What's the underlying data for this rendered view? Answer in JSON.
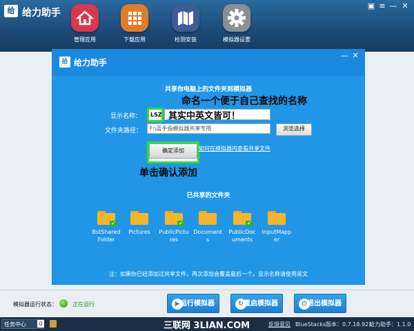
{
  "app": {
    "logo_text": "给",
    "title": "给力助手"
  },
  "nav": [
    {
      "label": "管理应用",
      "icon": "home-icon",
      "color": "#d8374e"
    },
    {
      "label": "下载应用",
      "icon": "grid-icon",
      "color": "#e07b2a"
    },
    {
      "label": "检测安装",
      "icon": "map-icon",
      "color": "#3d5c9a"
    },
    {
      "label": "模拟器设置",
      "icon": "gear-icon",
      "color": "#8a8f96"
    }
  ],
  "window_controls": {
    "skin": "▣",
    "menu": "≡",
    "minimize": "—",
    "close": "✕"
  },
  "dialog": {
    "logo_text": "给",
    "title": "给力助手",
    "minimize": "—",
    "close": "✕",
    "share_heading": "共享你电脑上的文件夹到模拟器",
    "annotation_name": "命名一个便于自己查找的名称",
    "display_name_label": "显示名称：",
    "display_name_value": "LSZ",
    "annotation_lang": "其实中英文皆可！",
    "folder_path_label": "文件夹路径：",
    "folder_path_value": "F:\\蓝手指模拟器共享专用",
    "browse_button": "浏览选择",
    "confirm_button": "确定添加",
    "view_link": "如何在模拟器内查看共享文件",
    "annotation_click": "单击确认添加",
    "shared_heading": "已共享的文件夹",
    "folders": [
      {
        "name": "BstSharedFolder"
      },
      {
        "name": "Pictures"
      },
      {
        "name": "PublicPictures"
      },
      {
        "name": "Documents"
      },
      {
        "name": "PublicDocuments"
      },
      {
        "name": "InputMapper"
      }
    ],
    "note": "注：如果你已经添加过共享文件，再次添加会覆盖最后一个。显示名称请使用英文"
  },
  "status": {
    "label": "模拟器运行状态：",
    "value": "正在运行"
  },
  "actions": [
    {
      "label": "运行模拟器",
      "icon": "play-icon",
      "glyph": "▶"
    },
    {
      "label": "重启模拟器",
      "icon": "restart-icon",
      "glyph": "↻"
    },
    {
      "label": "退出模拟器",
      "icon": "power-icon",
      "glyph": "⏻"
    }
  ],
  "taskbar": {
    "task_center": "任务中心",
    "badge": "0",
    "watermark": "三联网 3LIAN.COM",
    "feedback": "反馈意见",
    "version": "BlueStacks版本：0.7.18.921",
    "assistant_version": "给力助手：1.1.0"
  },
  "colors": {
    "accent": "#2196e6",
    "highlight": "#2ee02e",
    "topbar": "#1c4a76"
  }
}
